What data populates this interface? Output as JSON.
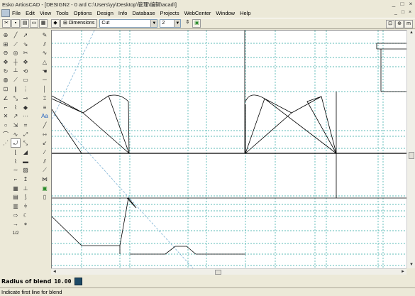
{
  "window": {
    "title": "Esko ArtiosCAD - [DESIGN2 - 0 ard C:\\Users\\yy\\Desktop\\管理\\编辑\\acad\\]",
    "controls": [
      "_",
      "□",
      "×"
    ]
  },
  "menubar": {
    "items": [
      "File",
      "Edit",
      "View",
      "Tools",
      "Options",
      "Design",
      "Info",
      "Database",
      "Projects",
      "WebCenter",
      "Window",
      "Help"
    ],
    "mdi_controls": [
      "_",
      "□",
      "×"
    ]
  },
  "toolbar": {
    "dimensions_label": "Dimensions",
    "layer_value": "Cut",
    "pointage_value": "2",
    "icons": [
      "cut-icon",
      "save-icon",
      "open-icon",
      "new-icon",
      "print-icon",
      "snap-icon",
      "zoom-icon",
      "grid-icon"
    ]
  },
  "tool_palette": {
    "colors": {
      "icon": "#333333",
      "accent": "#2060c0"
    },
    "blend_fraction_label": "1/2"
  },
  "canvas": {
    "background": "#ffffff",
    "guide_color": "#2aa5a0",
    "line_color": "#000000",
    "construction_color": "#7fb3d5"
  },
  "prompt": {
    "label": "Radius of blend",
    "value": "10.00"
  },
  "status": {
    "text": "Indicate first line for blend"
  }
}
